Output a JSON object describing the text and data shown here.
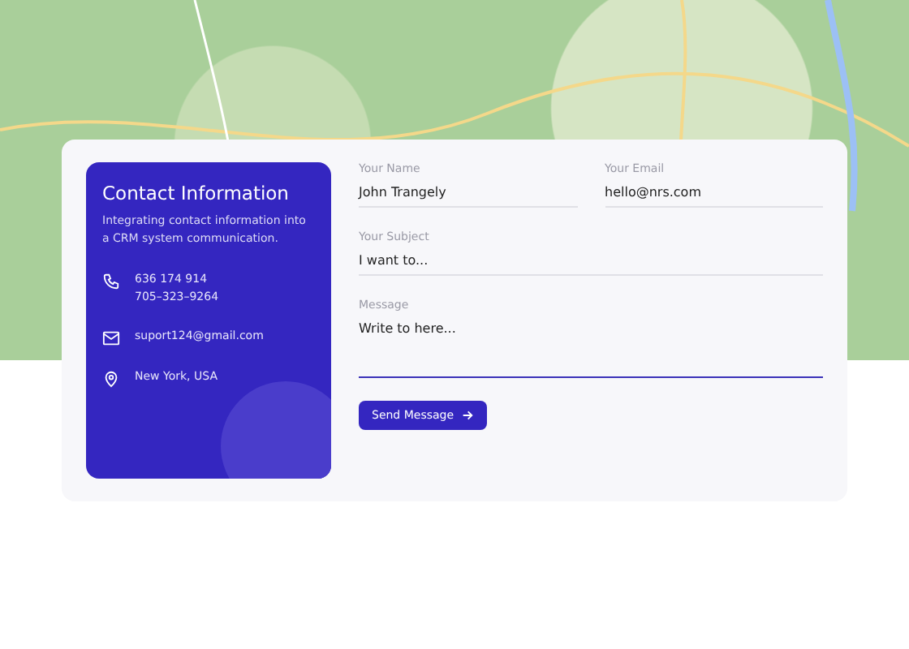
{
  "info": {
    "title": "Contact Information",
    "description": "Integrating contact information into a CRM system communication.",
    "items": [
      {
        "kind": "phone",
        "lines": [
          "636 174 914",
          "705–323–9264"
        ]
      },
      {
        "kind": "email",
        "lines": [
          "suport124@gmail.com"
        ]
      },
      {
        "kind": "location",
        "lines": [
          "New York, USA"
        ]
      }
    ]
  },
  "form": {
    "fields": [
      {
        "label": "Your Name",
        "value": "John Trangely",
        "focused": false
      },
      {
        "label": "Your Email",
        "value": "hello@nrs.com",
        "focused": false
      },
      {
        "label": "Your Subject",
        "value": "I want to...",
        "focused": false
      },
      {
        "label": "Message",
        "value": "Write to here...",
        "focused": true,
        "kind": "textarea"
      }
    ],
    "submit": "Send Message"
  }
}
